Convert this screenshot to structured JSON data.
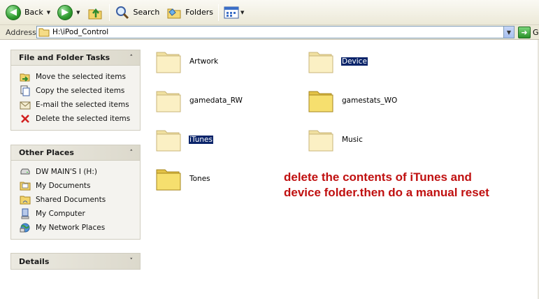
{
  "toolbar": {
    "back_label": "Back",
    "search_label": "Search",
    "folders_label": "Folders"
  },
  "address": {
    "label": "Address",
    "path": "H:\\iPod_Control",
    "go_label": "G"
  },
  "file_tasks": {
    "title": "File and Folder Tasks",
    "items": [
      {
        "label": "Move the selected items",
        "icon": "move-icon"
      },
      {
        "label": "Copy the selected items",
        "icon": "copy-icon"
      },
      {
        "label": "E-mail the selected items",
        "icon": "email-icon"
      },
      {
        "label": "Delete the selected items",
        "icon": "delete-icon"
      }
    ]
  },
  "other_places": {
    "title": "Other Places",
    "items": [
      {
        "label": "DW MAIN'S I (H:)",
        "icon": "drive-icon"
      },
      {
        "label": "My Documents",
        "icon": "my-documents-icon"
      },
      {
        "label": "Shared Documents",
        "icon": "shared-folder-icon"
      },
      {
        "label": "My Computer",
        "icon": "computer-icon"
      },
      {
        "label": "My Network Places",
        "icon": "network-icon"
      }
    ]
  },
  "details": {
    "title": "Details"
  },
  "folders": [
    {
      "name": "Artwork",
      "selected": false
    },
    {
      "name": "Device",
      "selected": true
    },
    {
      "name": "gamedata_RW",
      "selected": false
    },
    {
      "name": "gamestats_WO",
      "selected": false
    },
    {
      "name": "iTunes",
      "selected": true
    },
    {
      "name": "Music",
      "selected": false
    },
    {
      "name": "Tones",
      "selected": false
    }
  ],
  "annotation": {
    "line1": "delete the contents of iTunes and",
    "line2": "device folder.then do a manual reset"
  },
  "colors": {
    "selection": "#0a246a",
    "annotation": "#c01010",
    "folder": "#f6e7a8"
  }
}
